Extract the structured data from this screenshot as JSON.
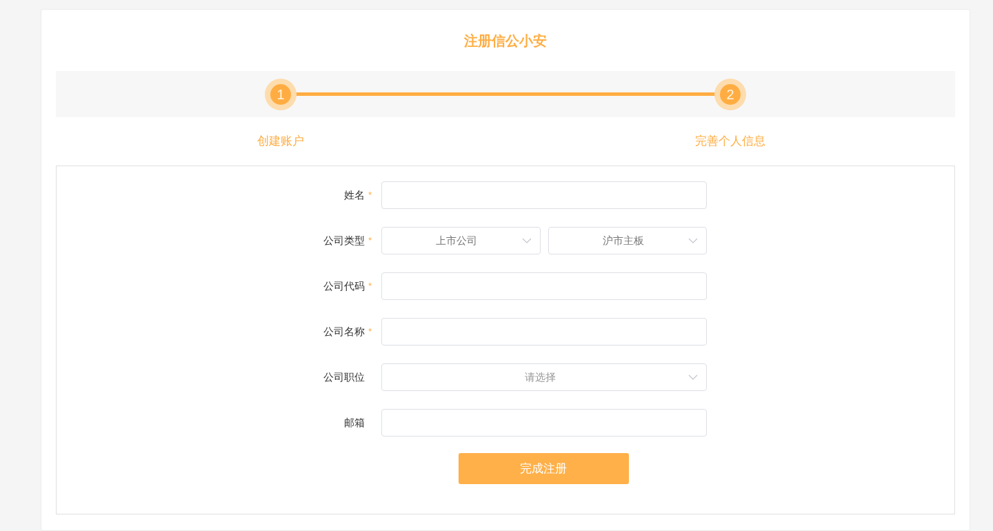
{
  "title": "注册信公小安",
  "steps": [
    {
      "number": "1",
      "label": "创建账户",
      "active": true
    },
    {
      "number": "2",
      "label": "完善个人信息",
      "active": true
    }
  ],
  "fields": [
    {
      "kind": "text",
      "label": "姓名",
      "required_mark": "*"
    },
    {
      "kind": "select_pair",
      "label": "公司类型",
      "required_mark": "*",
      "selects": [
        {
          "value": "上市公司"
        },
        {
          "value": "沪市主板"
        }
      ]
    },
    {
      "kind": "text",
      "label": "公司代码",
      "required_mark": "*"
    },
    {
      "kind": "text",
      "label": "公司名称",
      "required_mark": "*"
    },
    {
      "kind": "select",
      "label": "公司职位",
      "selects": [
        {
          "placeholder": "请选择"
        }
      ]
    },
    {
      "kind": "text",
      "label": "邮箱"
    }
  ],
  "submit_button": "完成注册"
}
